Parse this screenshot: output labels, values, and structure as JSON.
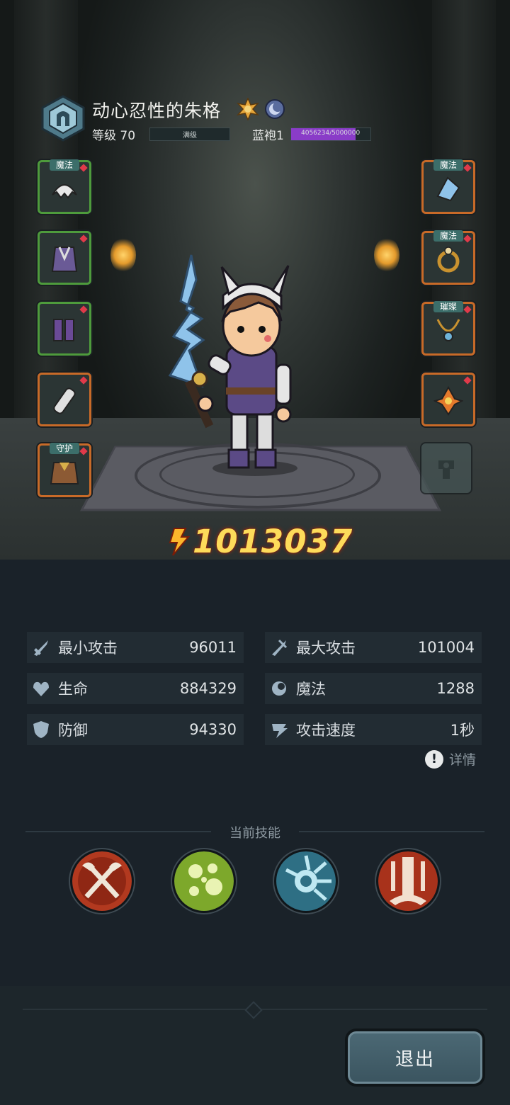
{
  "hero": {
    "name": "动心忍性的朱格",
    "level_label": "等级",
    "level": "70",
    "exp_label": "满级",
    "robe_label": "蓝袍1",
    "robe_progress_text": "4056234/5000000",
    "robe_progress": 0.81
  },
  "equipment": {
    "left": [
      {
        "tag": "魔法",
        "item": "helmet"
      },
      {
        "tag": "",
        "item": "robe"
      },
      {
        "tag": "",
        "item": "boots"
      },
      {
        "tag": "",
        "item": "scroll"
      },
      {
        "tag": "守护",
        "item": "guardian-armor"
      }
    ],
    "right": [
      {
        "tag": "魔法",
        "item": "bracer"
      },
      {
        "tag": "魔法",
        "item": "ring"
      },
      {
        "tag": "璀璨",
        "item": "necklace"
      },
      {
        "tag": "",
        "item": "gem-charm"
      },
      {
        "tag": "",
        "item": "empty-slot"
      }
    ]
  },
  "power": "1013037",
  "stats": [
    {
      "name": "最小攻击",
      "value": "96011",
      "icon": "sword-icon"
    },
    {
      "name": "最大攻击",
      "value": "101004",
      "icon": "sword-icon"
    },
    {
      "name": "生命",
      "value": "884329",
      "icon": "heart-icon"
    },
    {
      "name": "魔法",
      "value": "1288",
      "icon": "magic-icon"
    },
    {
      "name": "防御",
      "value": "94330",
      "icon": "shield-icon"
    },
    {
      "name": "攻击速度",
      "value": "1秒",
      "icon": "speed-icon"
    }
  ],
  "details_label": "详情",
  "skills_title": "当前技能",
  "skills": [
    "crossed-axes-skill",
    "green-orbs-skill",
    "burst-skill",
    "fire-pillar-skill"
  ],
  "exit_label": "退出",
  "colors": {
    "power": "#fddb5a",
    "green_border": "#4e9b3c",
    "orange_border": "#c86a28",
    "robe_fill": "#8a3cc8"
  }
}
